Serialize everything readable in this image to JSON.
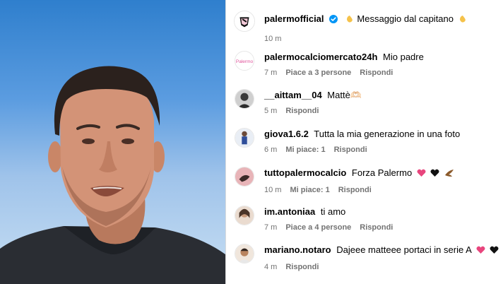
{
  "post": {
    "user": "palermofficial",
    "caption": "Messaggio dal capitano",
    "time": "10 m"
  },
  "comments": [
    {
      "user": "palermocalciomercato24h",
      "text": "Mio padre",
      "time": "7 m",
      "likes": "Piace a 3 persone",
      "reply": "Rispondi"
    },
    {
      "user": "__aittam__04",
      "text": "Mattè🫶🏻",
      "time": "5 m",
      "likes": "",
      "reply": "Rispondi"
    },
    {
      "user": "giova1.6.2",
      "text": "Tutta la mia generazione in una foto",
      "time": "6 m",
      "likes": "Mi piace: 1",
      "reply": "Rispondi"
    },
    {
      "user": "tuttopalermocalcio",
      "text": "Forza Palermo",
      "time": "10 m",
      "likes": "Mi piace: 1",
      "reply": "Rispondi"
    },
    {
      "user": "im.antoniaa",
      "text": "ti amo",
      "time": "7 m",
      "likes": "Piace a 4 persone",
      "reply": "Rispondi"
    },
    {
      "user": "mariano.notaro",
      "text": "Dajeee matteee portaci in serie A",
      "time": "4 m",
      "likes": "",
      "reply": "Rispondi"
    }
  ],
  "colors": {
    "verified": "#0095f6",
    "heart_pink": "#e8457d",
    "meta_gray": "#737373"
  },
  "icons": {
    "verified": "verified-badge-icon",
    "clap": "clapping-hands-emoji-icon",
    "pink_heart": "pink-heart-emoji-icon",
    "black_heart": "black-heart-emoji-icon",
    "eagle": "eagle-emoji-icon"
  }
}
